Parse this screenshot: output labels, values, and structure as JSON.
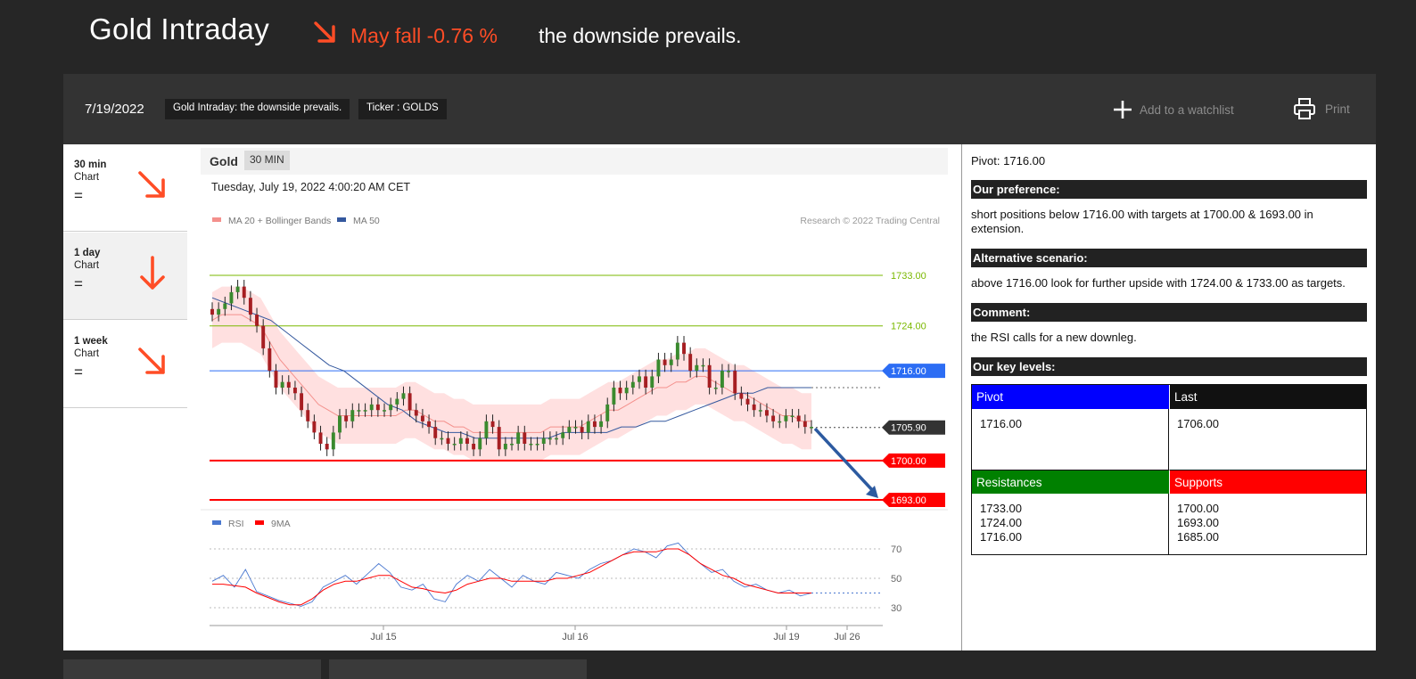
{
  "header": {
    "title": "Gold Intraday",
    "fall_text": "May fall -0.76 %",
    "subtitle": "the downside prevails.",
    "arrow_color": "#ff4d26"
  },
  "toolbar": {
    "date": "7/19/2022",
    "tag_title": "Gold Intraday: the downside prevails.",
    "tag_ticker": "Ticker : GOLDS",
    "watchlist_label": "Add to a watchlist",
    "print_label": "Print"
  },
  "sidebar": {
    "items": [
      {
        "period": "30 min",
        "chart": "Chart",
        "eq": "=",
        "direction": "down-right"
      },
      {
        "period": "1 day",
        "chart": "Chart",
        "eq": "=",
        "direction": "down"
      },
      {
        "period": "1 week",
        "chart": "Chart",
        "eq": "=",
        "direction": "down-right"
      }
    ]
  },
  "chart_header": {
    "name": "Gold",
    "timeframe": "30 MIN",
    "datetime": "Tuesday, July 19, 2022 4:00:20 AM CET"
  },
  "chart_data": {
    "type": "candlestick",
    "legend": [
      {
        "name": "MA 20 + Bollinger Bands",
        "color": "#f4908c"
      },
      {
        "name": "MA 50",
        "color": "#34589e"
      }
    ],
    "credit": "Research © 2022 Trading Central",
    "ylim": [
      1693,
      1736
    ],
    "levels": [
      {
        "label": "1733.00",
        "value": 1733,
        "color": "#7ab800",
        "kind": "resistance"
      },
      {
        "label": "1724.00",
        "value": 1724,
        "color": "#7ab800",
        "kind": "resistance"
      },
      {
        "label": "1716.00",
        "value": 1716,
        "color": "#2c6df4",
        "kind": "pivot"
      },
      {
        "label": "1705.90",
        "value": 1705.9,
        "color": "#333333",
        "kind": "last"
      },
      {
        "label": "1700.00",
        "value": 1700,
        "color": "#ff0000",
        "kind": "support"
      },
      {
        "label": "1693.00",
        "value": 1693,
        "color": "#ff0000",
        "kind": "support"
      }
    ],
    "close": [
      1726,
      1727,
      1728,
      1730,
      1731,
      1729,
      1726,
      1724,
      1720,
      1716,
      1713,
      1714,
      1713,
      1712,
      1709,
      1707,
      1705,
      1703,
      1702,
      1705,
      1708,
      1707,
      1709,
      1709,
      1709,
      1710,
      1709,
      1709,
      1710,
      1711,
      1712,
      1709,
      1708,
      1707,
      1706,
      1704,
      1704,
      1703,
      1703,
      1704,
      1703,
      1702,
      1704,
      1707,
      1706,
      1702,
      1703,
      1703,
      1705,
      1703,
      1703,
      1703,
      1704,
      1704,
      1704,
      1705,
      1706,
      1706,
      1705,
      1707,
      1706,
      1707,
      1710,
      1713,
      1712,
      1713,
      1714,
      1715,
      1713,
      1715,
      1718,
      1717,
      1718,
      1721,
      1719,
      1716,
      1717,
      1717,
      1713,
      1713,
      1716,
      1716,
      1712,
      1711,
      1710,
      1709,
      1709,
      1708,
      1707,
      1707,
      1708,
      1708,
      1707,
      1706,
      1706
    ],
    "ma20": [
      1725,
      1726,
      1726,
      1726,
      1725,
      1724,
      1721,
      1718,
      1716,
      1714,
      1712,
      1710,
      1709,
      1708,
      1708,
      1708,
      1708,
      1708,
      1708,
      1708,
      1709,
      1709,
      1708,
      1707,
      1707,
      1706,
      1706,
      1705,
      1705,
      1705,
      1705,
      1705,
      1705,
      1705,
      1705,
      1706,
      1706,
      1706,
      1706,
      1707,
      1708,
      1709,
      1709,
      1710,
      1711,
      1712,
      1713,
      1713,
      1714,
      1714,
      1715,
      1715,
      1714,
      1713,
      1712,
      1712,
      1711,
      1710,
      1709,
      1708,
      1708,
      1707,
      1707
    ],
    "ma50": [
      1729,
      1728,
      1727,
      1726,
      1725,
      1723,
      1721,
      1719,
      1717,
      1716,
      1714,
      1712,
      1710,
      1709,
      1707,
      1706,
      1705,
      1705,
      1704,
      1704,
      1704,
      1704,
      1704,
      1704,
      1705,
      1705,
      1705,
      1705,
      1706,
      1706,
      1707,
      1707,
      1708,
      1709,
      1710,
      1711,
      1712,
      1712,
      1713,
      1713,
      1713,
      1713
    ],
    "x_ticks": [
      "Jul 15",
      "Jul 16",
      "Jul 19",
      "Jul 26"
    ],
    "forecast": {
      "from": 1706,
      "to": 1693
    },
    "rsi": {
      "legend": [
        {
          "name": "RSI",
          "color": "#4a78d0"
        },
        {
          "name": "9MA",
          "color": "#ff0000"
        }
      ],
      "ticks": [
        "70",
        "50",
        "30"
      ],
      "rsi_values": [
        48,
        52,
        44,
        56,
        41,
        38,
        35,
        33,
        31,
        34,
        44,
        48,
        52,
        46,
        53,
        60,
        54,
        44,
        42,
        46,
        36,
        34,
        46,
        52,
        48,
        56,
        50,
        44,
        52,
        48,
        46,
        54,
        52,
        50,
        56,
        60,
        62,
        66,
        70,
        68,
        64,
        72,
        74,
        66,
        60,
        54,
        56,
        48,
        44,
        46,
        42,
        40,
        42,
        38,
        40
      ],
      "ma_values": [
        46,
        46,
        45,
        44,
        40,
        37,
        34,
        32,
        32,
        36,
        42,
        46,
        48,
        48,
        50,
        52,
        52,
        48,
        44,
        43,
        41,
        40,
        42,
        46,
        48,
        50,
        50,
        48,
        48,
        48,
        48,
        50,
        50,
        52,
        54,
        58,
        62,
        66,
        68,
        68,
        68,
        70,
        70,
        66,
        60,
        56,
        52,
        50,
        46,
        44,
        42,
        40,
        40,
        40,
        40
      ]
    }
  },
  "analysis": {
    "pivot_line": "Pivot: 1716.00",
    "preference_title": "Our preference:",
    "preference_text": "short positions below 1716.00 with targets at 1700.00 & 1693.00 in extension.",
    "alternative_title": "Alternative scenario:",
    "alternative_text": "above 1716.00 look for further upside with 1724.00 & 1733.00 as targets.",
    "comment_title": "Comment:",
    "comment_text": "the RSI calls for a new downleg.",
    "key_levels_title": "Our key levels:",
    "key_levels": {
      "pivot_label": "Pivot",
      "pivot_value": "1716.00",
      "last_label": "Last",
      "last_value": "1706.00",
      "resistances_label": "Resistances",
      "resistances": [
        "1733.00",
        "1724.00",
        "1716.00"
      ],
      "supports_label": "Supports",
      "supports": [
        "1700.00",
        "1693.00",
        "1685.00"
      ],
      "pivot_color": "#0000ff",
      "last_color": "#111111",
      "resistance_color": "#008000",
      "support_color": "#ff0000"
    }
  }
}
